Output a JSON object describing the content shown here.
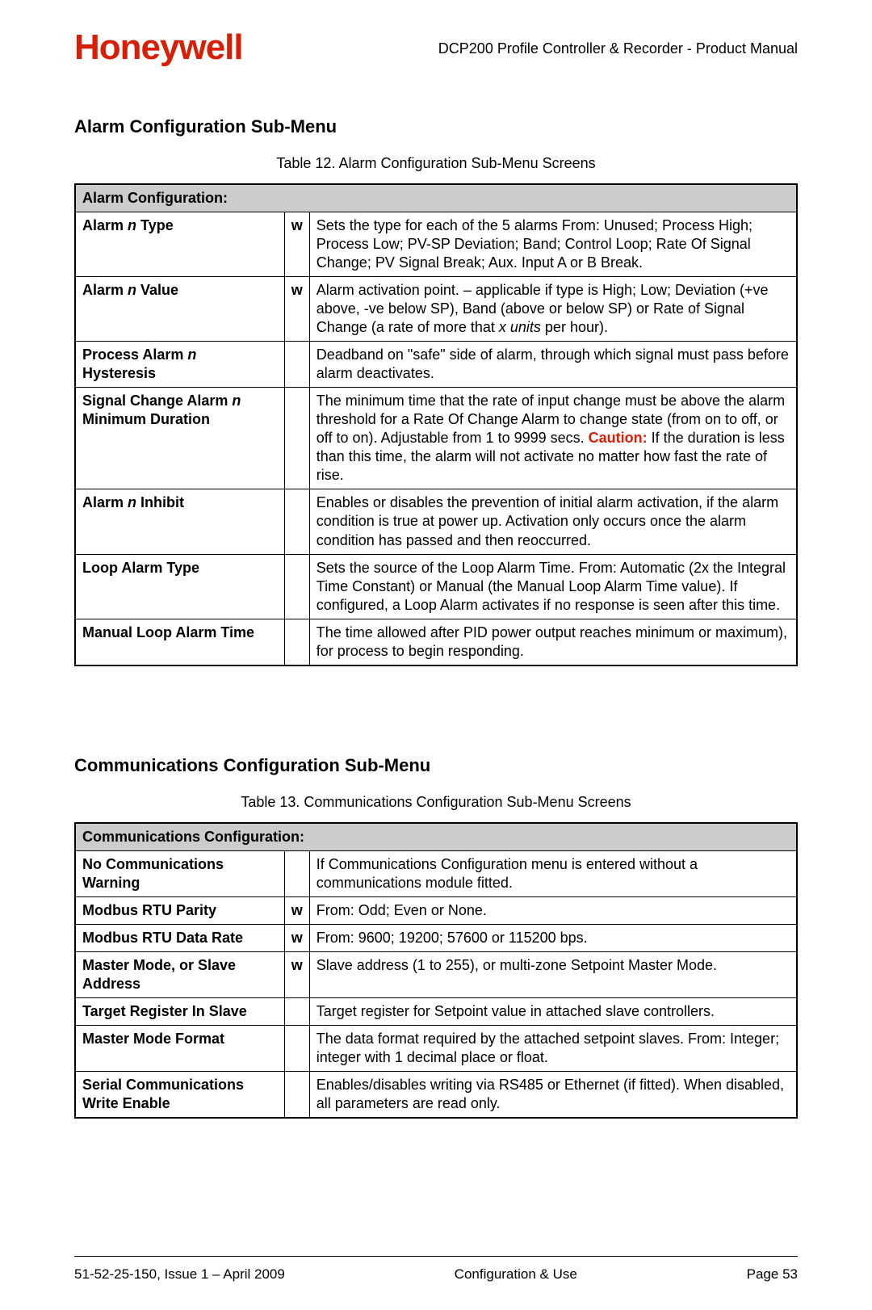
{
  "header": {
    "logo_text": "Honeywell",
    "doc_title": "DCP200 Profile Controller & Recorder - Product Manual"
  },
  "section1": {
    "heading": "Alarm Configuration Sub-Menu",
    "caption": "Table 12. Alarm Configuration Sub-Menu Screens",
    "table_title": "Alarm Configuration:",
    "rows": [
      {
        "label_pre": "Alarm ",
        "label_ital": "n",
        "label_post": " Type",
        "mid": "w",
        "desc": "Sets the type for each of the 5 alarms From: Unused; Process High; Process Low; PV-SP Deviation; Band; Control Loop; Rate Of Signal Change; PV Signal Break; Aux. Input A or B Break."
      },
      {
        "label_pre": "Alarm ",
        "label_ital": "n",
        "label_post": " Value",
        "mid": "w",
        "desc_pre": "Alarm activation point. – applicable if type is High; Low; Deviation (+ve above, -ve below SP), Band (above or below SP) or Rate of Signal Change (a rate of more that ",
        "desc_ital": "x units",
        "desc_post": " per hour)."
      },
      {
        "label_pre": "Process Alarm ",
        "label_ital": "n",
        "label_post2_line": " Hysteresis",
        "mid": "",
        "desc": "Deadband on \"safe\" side of alarm, through which signal must pass before alarm deactivates."
      },
      {
        "label_pre": "Signal Change Alarm ",
        "label_ital": "n",
        "label_post2_line": " Minimum Duration",
        "mid": "",
        "desc_pre": "The minimum time that the rate of input change must be above the alarm threshold for a Rate Of Change Alarm to change state (from on to off, or off to on). Adjustable from 1 to 9999 secs. ",
        "desc_red": "Caution:",
        "desc_post": " If the duration is less than this time, the alarm will not activate no matter how fast the rate of rise."
      },
      {
        "label_pre": "Alarm ",
        "label_ital": "n",
        "label_post": " Inhibit",
        "mid": "",
        "desc": "Enables or disables the prevention of initial alarm activation, if the alarm condition is true at power up. Activation only occurs once the alarm condition has passed and then reoccurred."
      },
      {
        "label_plain": "Loop Alarm Type",
        "mid": "",
        "desc": "Sets the source of the Loop Alarm Time. From: Automatic (2x the Integral Time Constant) or Manual (the Manual Loop Alarm Time value). If configured, a Loop Alarm activates if no response is seen after this time."
      },
      {
        "label_plain": "Manual Loop Alarm Time",
        "mid": "",
        "desc": "The time allowed after PID power output reaches minimum or maximum), for process to begin responding."
      }
    ]
  },
  "section2": {
    "heading": "Communications Configuration Sub-Menu",
    "caption": "Table 13. Communications Configuration Sub-Menu Screens",
    "table_title": "Communications Configuration:",
    "rows": [
      {
        "label": "No Communications Warning",
        "mid": "",
        "desc": "If Communications Configuration menu is entered without a communications module fitted."
      },
      {
        "label": "Modbus RTU Parity",
        "mid": "w",
        "desc": "From: Odd; Even or None."
      },
      {
        "label": "Modbus RTU Data Rate",
        "mid": "w",
        "desc": "From: 9600; 19200; 57600 or 115200 bps."
      },
      {
        "label": "Master Mode, or Slave Address",
        "mid": "w",
        "desc": "Slave address (1 to 255), or multi-zone Setpoint Master Mode."
      },
      {
        "label": "Target Register In Slave",
        "mid": "",
        "desc": "Target register for Setpoint value in attached slave controllers."
      },
      {
        "label": "Master Mode Format",
        "mid": "",
        "desc": "The data format required by the attached setpoint slaves. From: Integer; integer with 1 decimal place or float."
      },
      {
        "label": "Serial Communications Write Enable",
        "mid": "",
        "desc": "Enables/disables writing via RS485 or Ethernet (if fitted). When disabled, all parameters are read only."
      }
    ]
  },
  "footer": {
    "left": "51-52-25-150, Issue 1 – April 2009",
    "center": "Configuration & Use",
    "right": "Page 53"
  }
}
